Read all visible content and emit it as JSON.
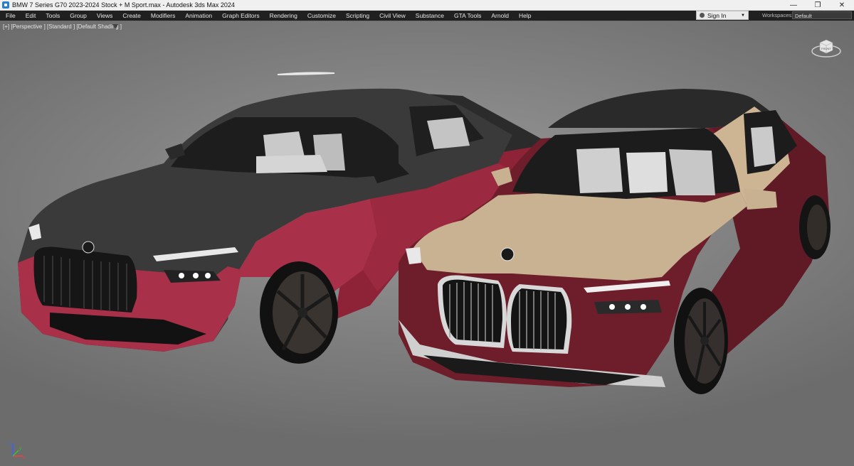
{
  "window": {
    "title": "BMW 7 Series G70 2023-2024 Stock + M Sport.max - Autodesk 3ds Max 2024",
    "controls": {
      "minimize": "—",
      "maximize": "❐",
      "close": "✕"
    }
  },
  "menu": {
    "items": [
      "File",
      "Edit",
      "Tools",
      "Group",
      "Views",
      "Create",
      "Modifiers",
      "Animation",
      "Graph Editors",
      "Rendering",
      "Customize",
      "Scripting",
      "Civil View",
      "Substance",
      "GTA Tools",
      "Arnold",
      "Help"
    ]
  },
  "account": {
    "sign_in": "Sign In"
  },
  "workspaces": {
    "label": "Workspaces:",
    "value": "Default"
  },
  "viewport": {
    "label": "[+] [Perspective ] [Standard ] [Default Shading ]",
    "viewcube_face": "FRONT"
  },
  "axis": {
    "x": "x",
    "y": "y",
    "z": "z"
  },
  "colors": {
    "menubar": "#202020",
    "left_car_body": "#a93049",
    "left_car_hood": "#3a3a3a",
    "right_car_body": "#6e1e2a",
    "right_car_hood": "#c9b291"
  }
}
